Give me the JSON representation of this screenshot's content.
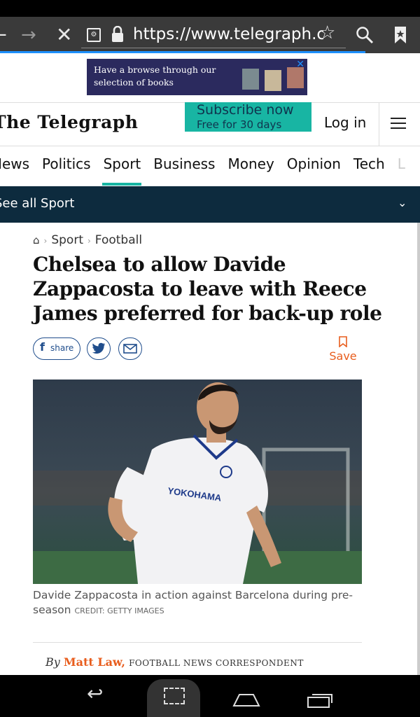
{
  "browser": {
    "url": "https://www.telegraph.c",
    "icons": [
      "back-arrow-icon",
      "forward-arrow-icon",
      "stop-icon",
      "site-settings-icon",
      "lock-icon",
      "star-icon",
      "search-icon",
      "bookmark-icon"
    ]
  },
  "ad": {
    "text": "Have a browse through our selection of books",
    "close": "✕"
  },
  "header": {
    "logo": "The Telegraph",
    "subscribe_main": "Subscribe now",
    "subscribe_sub": "Free for 30 days",
    "login": "Log in"
  },
  "nav": {
    "items": [
      "News",
      "Politics",
      "Sport",
      "Business",
      "Money",
      "Opinion",
      "Tech",
      "L"
    ],
    "active": "Sport"
  },
  "seeall": {
    "label": "See all Sport"
  },
  "article": {
    "breadcrumb": [
      "Sport",
      "Football"
    ],
    "title": "Chelsea to allow Davide Zappacosta to leave with Reece James preferred for back-up role",
    "share_label": "share",
    "save_label": "Save",
    "caption": "Davide Zappacosta in action against Barcelona during pre-season",
    "credit": "CREDIT: GETTY IMAGES",
    "byline_prefix": "By",
    "author": "Matt Law,",
    "role": "FOOTBALL NEWS CORRESPONDENT",
    "photo_shirt_text": "YOKOHAMA"
  },
  "colors": {
    "accent_teal": "#18b5a3",
    "navy": "#0d2b3e",
    "author_orange": "#e85d1d",
    "share_blue": "#1f4d8c"
  }
}
